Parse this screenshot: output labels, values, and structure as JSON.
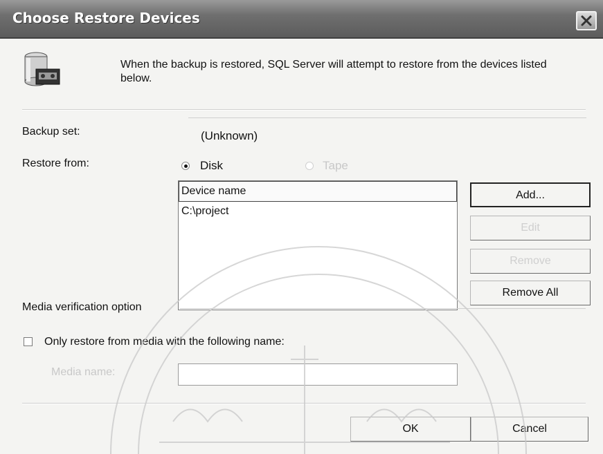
{
  "window": {
    "title": "Choose Restore Devices"
  },
  "intro": {
    "text": "When the backup is restored, SQL Server will attempt to restore from the devices listed below."
  },
  "backup_set": {
    "label": "Backup set:",
    "value": "(Unknown)"
  },
  "restore_from": {
    "label": "Restore from:",
    "options": [
      {
        "label": "Disk",
        "selected": true,
        "enabled": true
      },
      {
        "label": "Tape",
        "selected": false,
        "enabled": false
      }
    ]
  },
  "devices": {
    "column_header": "Device name",
    "items": [
      "C:\\project"
    ]
  },
  "buttons": {
    "add": "Add...",
    "edit": "Edit",
    "remove": "Remove",
    "remove_all": "Remove All",
    "ok": "OK",
    "cancel": "Cancel"
  },
  "media_verification": {
    "label": "Media verification option",
    "checkbox_label": "Only restore from media with the following name:",
    "checked": false,
    "media_name_label": "Media name:",
    "media_name_value": ""
  },
  "icons": {
    "dialog_icon": "database-tape-icon",
    "close": "close-icon"
  },
  "colors": {
    "titlebar": "#6f6f6f",
    "dialog_bg": "#f4f4f2",
    "disabled_text": "#c8c8c8"
  }
}
